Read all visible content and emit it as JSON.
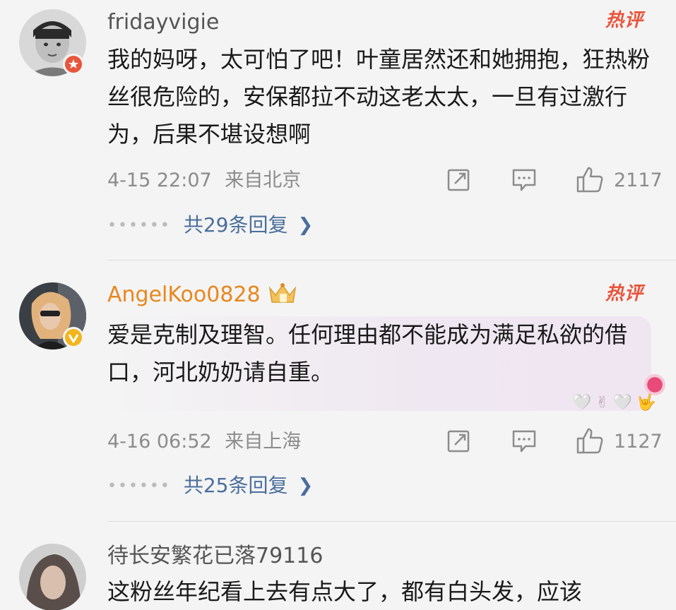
{
  "comments": [
    {
      "username": "fridayvigie",
      "hot_label": "热评",
      "text": "我的妈呀，太可怕了吧！叶童居然还和她拥抱，狂热粉丝很危险的，安保都拉不动这老太太，一旦有过激行为，后果不堪设想啊",
      "time": "4-15 22:07",
      "location": "来自北京",
      "likes": "2117",
      "replies": "共29条回复",
      "badge_icon": "red-star-badge-icon"
    },
    {
      "username": "AngelKoo0828",
      "hot_label": "热评",
      "text": "爱是克制及理智。任何理由都不能成为满足私欲的借口，河北奶奶请自重。",
      "time": "4-16 06:52",
      "location": "来自上海",
      "likes": "1127",
      "replies": "共25条回复",
      "badge_icon": "verified-v-badge-icon"
    },
    {
      "username": "待长安繁花已落79116",
      "text": "这粉丝年纪看上去有点大了，都有白头发，应该"
    }
  ],
  "icons": {
    "repost": "repost-icon",
    "comment": "comment-icon",
    "like": "thumbs-up-icon",
    "chevron": "chevron-right-icon",
    "crown": "crown-badge-icon"
  },
  "colors": {
    "hot_label": "#e8553c",
    "vip_username": "#e8871e",
    "reply_link": "#4a6e9c",
    "meta_text": "#8c8c8c"
  }
}
